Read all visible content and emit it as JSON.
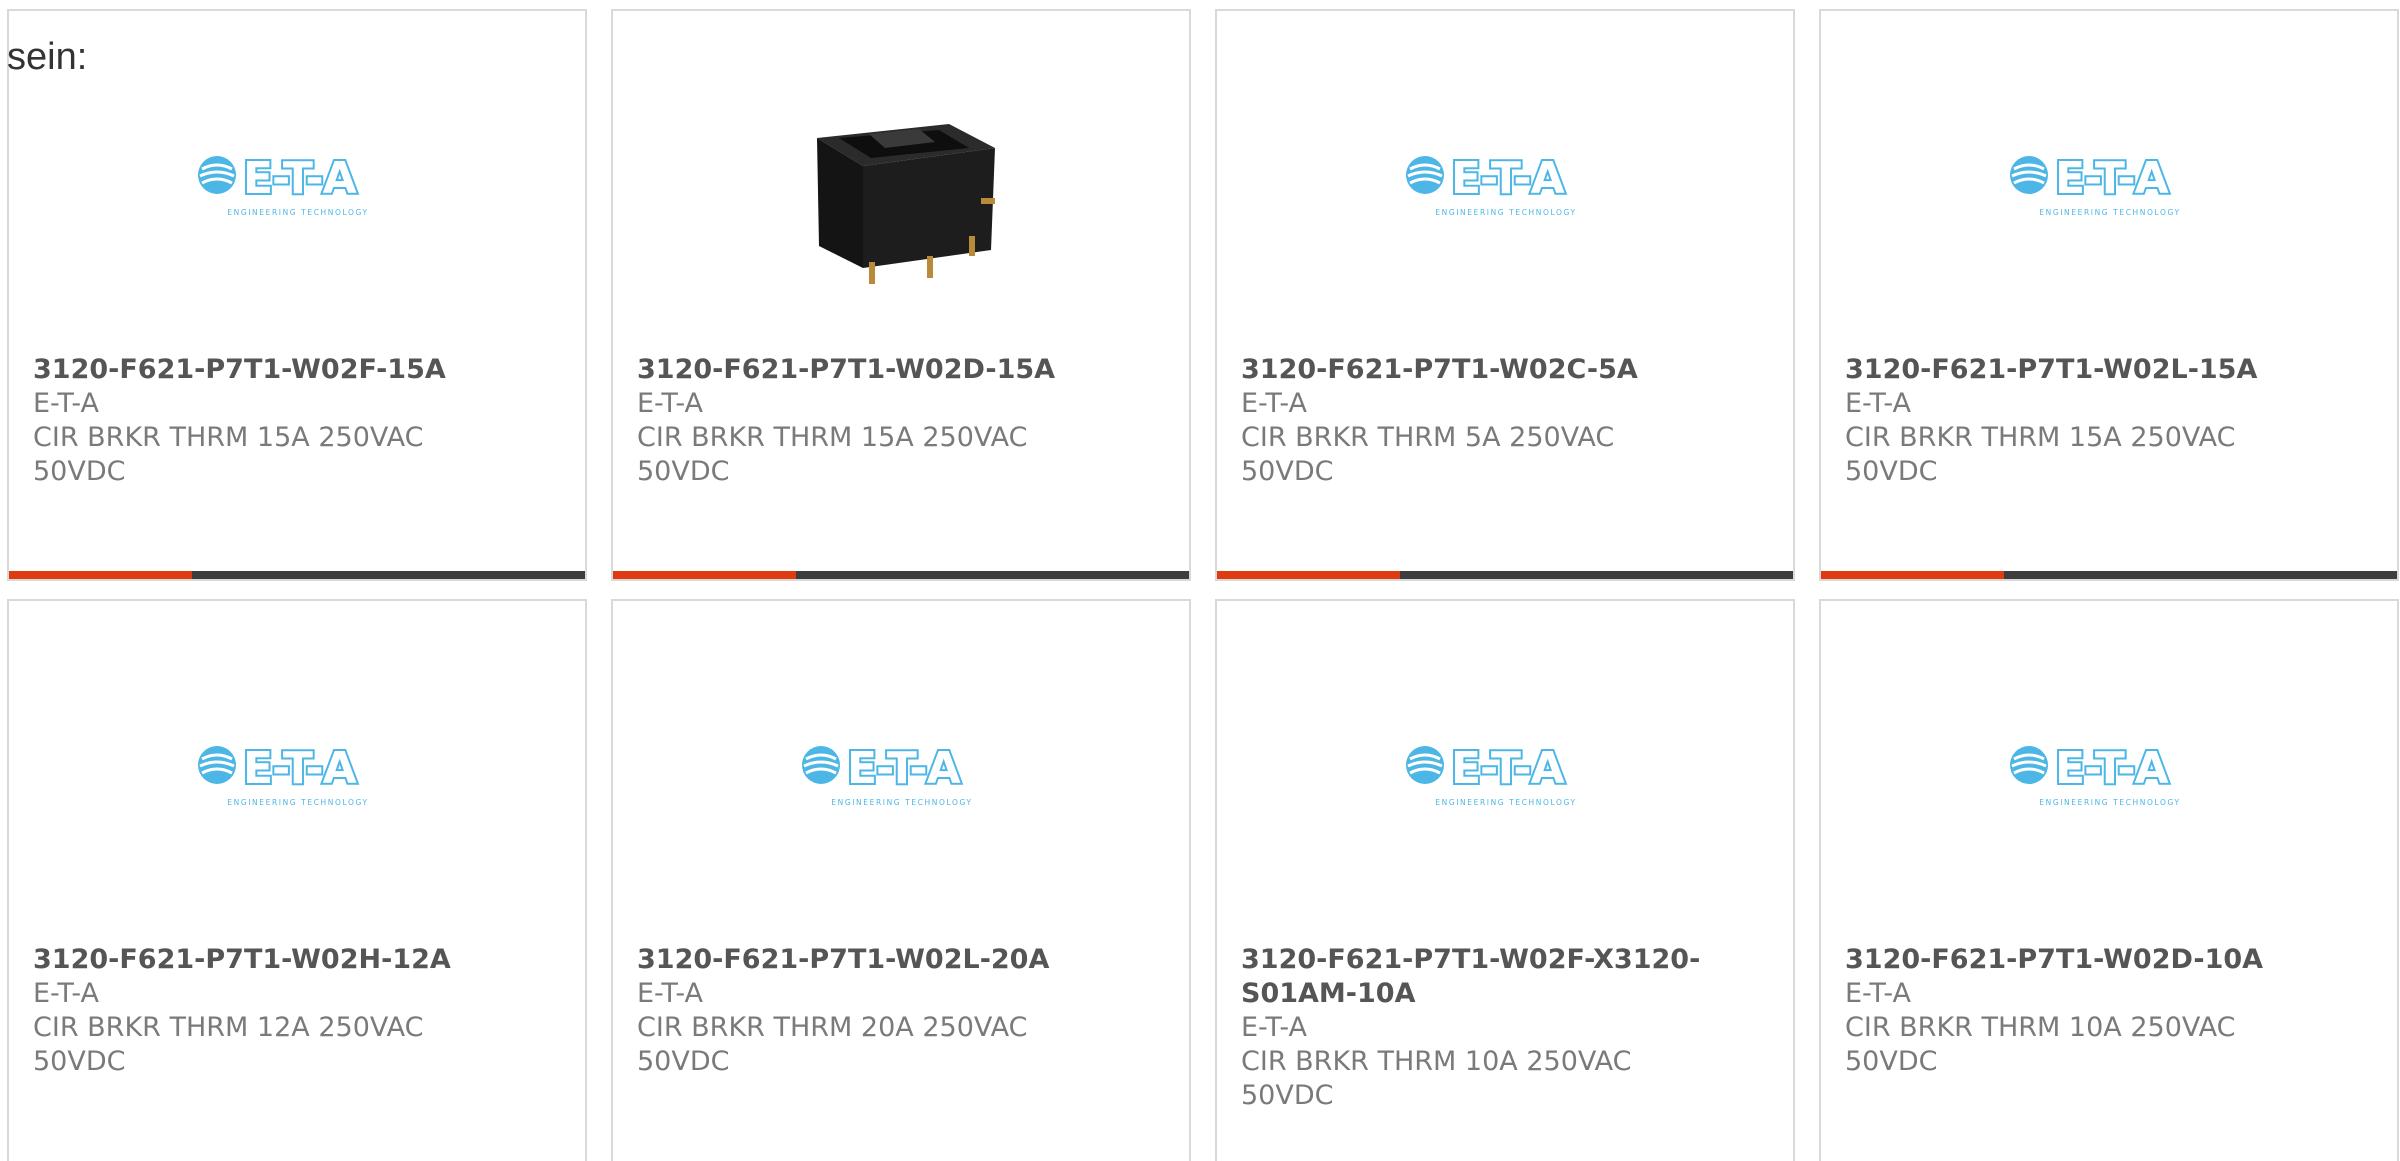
{
  "intro_text": "sein:",
  "colors": {
    "accent": "#e03a12",
    "bar_dark": "#3d3d3d",
    "logo_blue": "#4cb6e6",
    "card_border": "#d9d9d9"
  },
  "logo": {
    "wordmark": "E-T-A",
    "tagline": "ENGINEERING TECHNOLOGY"
  },
  "products": [
    {
      "part_number": "3120-F621-P7T1-W02F-15A",
      "manufacturer": "E-T-A",
      "description": "CIR BRKR THRM 15A 250VAC 50VDC",
      "image": "eta-logo"
    },
    {
      "part_number": "3120-F621-P7T1-W02D-15A",
      "manufacturer": "E-T-A",
      "description": "CIR BRKR THRM 15A 250VAC 50VDC",
      "image": "rocker-switch-photo"
    },
    {
      "part_number": "3120-F621-P7T1-W02C-5A",
      "manufacturer": "E-T-A",
      "description": "CIR BRKR THRM 5A 250VAC 50VDC",
      "image": "eta-logo"
    },
    {
      "part_number": "3120-F621-P7T1-W02L-15A",
      "manufacturer": "E-T-A",
      "description": "CIR BRKR THRM 15A 250VAC 50VDC",
      "image": "eta-logo"
    },
    {
      "part_number": "3120-F621-P7T1-W02H-12A",
      "manufacturer": "E-T-A",
      "description": "CIR BRKR THRM 12A 250VAC 50VDC",
      "image": "eta-logo"
    },
    {
      "part_number": "3120-F621-P7T1-W02L-20A",
      "manufacturer": "E-T-A",
      "description": "CIR BRKR THRM 20A 250VAC 50VDC",
      "image": "eta-logo"
    },
    {
      "part_number": "3120-F621-P7T1-W02F-X3120-S01AM-10A",
      "manufacturer": "E-T-A",
      "description": "CIR BRKR THRM 10A 250VAC 50VDC",
      "image": "eta-logo"
    },
    {
      "part_number": "3120-F621-P7T1-W02D-10A",
      "manufacturer": "E-T-A",
      "description": "CIR BRKR THRM 10A 250VAC 50VDC",
      "image": "eta-logo"
    }
  ]
}
